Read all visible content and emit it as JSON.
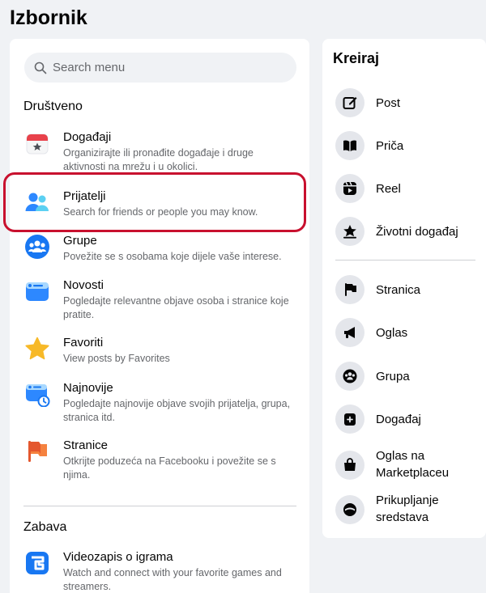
{
  "page_title": "Izbornik",
  "search": {
    "placeholder": "Search menu"
  },
  "sections": {
    "social": "Društveno",
    "entertainment": "Zabava"
  },
  "menu_items": [
    {
      "label": "Događaji",
      "desc": "Organizirajte ili pronađite događaje i druge aktivnosti na mrežu i u okolici.",
      "icon": "calendar-icon"
    },
    {
      "label": "Prijatelji",
      "desc": "Search for friends or people you may know.",
      "icon": "friends-icon"
    },
    {
      "label": "Grupe",
      "desc": "Povežite se s osobama koje dijele vaše interese.",
      "icon": "groups-icon"
    },
    {
      "label": "Novosti",
      "desc": "Pogledajte relevantne objave osoba i stranice koje pratite.",
      "icon": "feed-icon"
    },
    {
      "label": "Favoriti",
      "desc": "View posts by Favorites",
      "icon": "star-icon"
    },
    {
      "label": "Najnovije",
      "desc": "Pogledajte najnovije objave svojih prijatelja, grupa, stranica itd.",
      "icon": "recent-icon"
    },
    {
      "label": "Stranice",
      "desc": "Otkrijte poduzeća na Facebooku i povežite se s njima.",
      "icon": "flag-icon"
    },
    {
      "label": "Videozapis o igrama",
      "desc": "Watch and connect with your favorite games and streamers.",
      "icon": "gaming-video-icon"
    }
  ],
  "create": {
    "title": "Kreiraj",
    "items": [
      {
        "label": "Post",
        "icon": "edit-icon"
      },
      {
        "label": "Priča",
        "icon": "book-icon"
      },
      {
        "label": "Reel",
        "icon": "reel-icon"
      },
      {
        "label": "Životni događaj",
        "icon": "life-event-icon"
      },
      {
        "label": "Stranica",
        "icon": "flag-icon"
      },
      {
        "label": "Oglas",
        "icon": "megaphone-icon"
      },
      {
        "label": "Grupa",
        "icon": "group-icon"
      },
      {
        "label": "Događaj",
        "icon": "event-icon"
      },
      {
        "label": "Oglas na Marketplaceu",
        "icon": "marketplace-icon"
      },
      {
        "label": "Prikupljanje sredstava",
        "icon": "fundraiser-icon"
      }
    ]
  },
  "colors": {
    "highlight": "#c8102e",
    "accent_blue": "#1877f2"
  }
}
